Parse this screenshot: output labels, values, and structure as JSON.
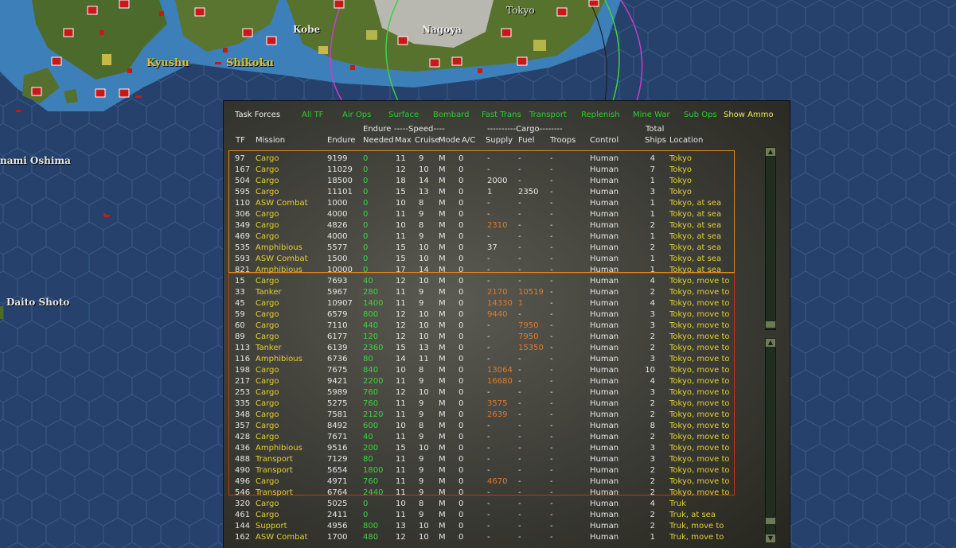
{
  "map": {
    "labels": [
      "Kobe",
      "Nagoya",
      "Tokyo",
      "Kyushu",
      "Shikoku",
      "nami Oshima",
      "Daito Shoto"
    ]
  },
  "tabs": [
    "Task Forces",
    "All TF",
    "Air Ops",
    "Surface",
    "Bombard",
    "Fast Trans",
    "Transport",
    "Replenish",
    "Mine War",
    "Sub Ops",
    "Show Ammo"
  ],
  "headers": {
    "endure_top": "Endure",
    "speed_top": "-----Speed----",
    "cargo_top": "----------Cargo--------",
    "total_top": "Total",
    "tf": "TF",
    "mission": "Mission",
    "endure": "Endure",
    "needed": "Needed",
    "max": "Max",
    "cruise": "Cruise",
    "mode": "Mode",
    "ac": "A/C",
    "supply": "Supply",
    "fuel": "Fuel",
    "troops": "Troops",
    "control": "Control",
    "ships": "Ships",
    "location": "Location"
  },
  "colors": {
    "yellow": "#e3cf2e",
    "green": "#3fd23f",
    "orange": "#e07a2a",
    "white": "#e6e6e6",
    "group_tokyo_border": "#d98a1a",
    "group_moveto_border": "#c8321e"
  },
  "rows": [
    {
      "tf": "97",
      "mission": "Cargo",
      "endure": "9199",
      "needed": "0",
      "max": "11",
      "cruise": "9",
      "mode": "M",
      "ac": "0",
      "supply": "-",
      "fuel": "-",
      "troops": "-",
      "control": "Human",
      "ships": "4",
      "location": "Tokyo"
    },
    {
      "tf": "167",
      "mission": "Cargo",
      "endure": "11029",
      "needed": "0",
      "max": "12",
      "cruise": "10",
      "mode": "M",
      "ac": "0",
      "supply": "-",
      "fuel": "-",
      "troops": "-",
      "control": "Human",
      "ships": "7",
      "location": "Tokyo"
    },
    {
      "tf": "504",
      "mission": "Cargo",
      "endure": "18500",
      "needed": "0",
      "max": "18",
      "cruise": "14",
      "mode": "M",
      "ac": "0",
      "supply": "2000",
      "fuel": "-",
      "troops": "-",
      "control": "Human",
      "ships": "1",
      "location": "Tokyo"
    },
    {
      "tf": "595",
      "mission": "Cargo",
      "endure": "11101",
      "needed": "0",
      "max": "15",
      "cruise": "13",
      "mode": "M",
      "ac": "0",
      "supply": "1",
      "fuel": "2350",
      "troops": "-",
      "control": "Human",
      "ships": "3",
      "location": "Tokyo"
    },
    {
      "tf": "110",
      "mission": "ASW Combat",
      "endure": "1000",
      "needed": "0",
      "max": "10",
      "cruise": "8",
      "mode": "M",
      "ac": "0",
      "supply": "-",
      "fuel": "-",
      "troops": "-",
      "control": "Human",
      "ships": "1",
      "location": "Tokyo, at sea"
    },
    {
      "tf": "306",
      "mission": "Cargo",
      "endure": "4000",
      "needed": "0",
      "max": "11",
      "cruise": "9",
      "mode": "M",
      "ac": "0",
      "supply": "-",
      "fuel": "-",
      "troops": "-",
      "control": "Human",
      "ships": "1",
      "location": "Tokyo, at sea"
    },
    {
      "tf": "349",
      "mission": "Cargo",
      "endure": "4826",
      "needed": "0",
      "max": "10",
      "cruise": "8",
      "mode": "M",
      "ac": "0",
      "supply": "2310",
      "fuel": "-",
      "troops": "-",
      "control": "Human",
      "ships": "2",
      "location": "Tokyo, at sea"
    },
    {
      "tf": "469",
      "mission": "Cargo",
      "endure": "4000",
      "needed": "0",
      "max": "11",
      "cruise": "9",
      "mode": "M",
      "ac": "0",
      "supply": "-",
      "fuel": "-",
      "troops": "-",
      "control": "Human",
      "ships": "1",
      "location": "Tokyo, at sea"
    },
    {
      "tf": "535",
      "mission": "Amphibious",
      "endure": "5577",
      "needed": "0",
      "max": "15",
      "cruise": "10",
      "mode": "M",
      "ac": "0",
      "supply": "37",
      "fuel": "-",
      "troops": "-",
      "control": "Human",
      "ships": "2",
      "location": "Tokyo, at sea"
    },
    {
      "tf": "593",
      "mission": "ASW Combat",
      "endure": "1500",
      "needed": "0",
      "max": "15",
      "cruise": "10",
      "mode": "M",
      "ac": "0",
      "supply": "-",
      "fuel": "-",
      "troops": "-",
      "control": "Human",
      "ships": "1",
      "location": "Tokyo, at sea"
    },
    {
      "tf": "821",
      "mission": "Amphibious",
      "endure": "10000",
      "needed": "0",
      "max": "17",
      "cruise": "14",
      "mode": "M",
      "ac": "0",
      "supply": "-",
      "fuel": "-",
      "troops": "-",
      "control": "Human",
      "ships": "1",
      "location": "Tokyo, at sea"
    },
    {
      "tf": "15",
      "mission": "Cargo",
      "endure": "7693",
      "needed": "40",
      "max": "12",
      "cruise": "10",
      "mode": "M",
      "ac": "0",
      "supply": "-",
      "fuel": "-",
      "troops": "-",
      "control": "Human",
      "ships": "4",
      "location": "Tokyo, move to"
    },
    {
      "tf": "33",
      "mission": "Tanker",
      "endure": "5967",
      "needed": "280",
      "max": "11",
      "cruise": "9",
      "mode": "M",
      "ac": "0",
      "supply": "2170",
      "fuel": "10519",
      "troops": "-",
      "control": "Human",
      "ships": "2",
      "location": "Tokyo, move to"
    },
    {
      "tf": "45",
      "mission": "Cargo",
      "endure": "10907",
      "needed": "1400",
      "max": "11",
      "cruise": "9",
      "mode": "M",
      "ac": "0",
      "supply": "14330",
      "fuel": "1",
      "troops": "-",
      "control": "Human",
      "ships": "4",
      "location": "Tokyo, move to"
    },
    {
      "tf": "59",
      "mission": "Cargo",
      "endure": "6579",
      "needed": "800",
      "max": "12",
      "cruise": "10",
      "mode": "M",
      "ac": "0",
      "supply": "9440",
      "fuel": "-",
      "troops": "-",
      "control": "Human",
      "ships": "3",
      "location": "Tokyo, move to"
    },
    {
      "tf": "60",
      "mission": "Cargo",
      "endure": "7110",
      "needed": "440",
      "max": "12",
      "cruise": "10",
      "mode": "M",
      "ac": "0",
      "supply": "-",
      "fuel": "7950",
      "troops": "-",
      "control": "Human",
      "ships": "3",
      "location": "Tokyo, move to"
    },
    {
      "tf": "89",
      "mission": "Cargo",
      "endure": "6177",
      "needed": "120",
      "max": "12",
      "cruise": "10",
      "mode": "M",
      "ac": "0",
      "supply": "-",
      "fuel": "7950",
      "troops": "-",
      "control": "Human",
      "ships": "2",
      "location": "Tokyo, move to"
    },
    {
      "tf": "113",
      "mission": "Tanker",
      "endure": "6139",
      "needed": "2360",
      "max": "15",
      "cruise": "13",
      "mode": "M",
      "ac": "0",
      "supply": "-",
      "fuel": "15350",
      "troops": "-",
      "control": "Human",
      "ships": "2",
      "location": "Tokyo, move to"
    },
    {
      "tf": "116",
      "mission": "Amphibious",
      "endure": "6736",
      "needed": "80",
      "max": "14",
      "cruise": "11",
      "mode": "M",
      "ac": "0",
      "supply": "-",
      "fuel": "-",
      "troops": "-",
      "control": "Human",
      "ships": "3",
      "location": "Tokyo, move to"
    },
    {
      "tf": "198",
      "mission": "Cargo",
      "endure": "7675",
      "needed": "840",
      "max": "10",
      "cruise": "8",
      "mode": "M",
      "ac": "0",
      "supply": "13064",
      "fuel": "-",
      "troops": "-",
      "control": "Human",
      "ships": "10",
      "location": "Tokyo, move to"
    },
    {
      "tf": "217",
      "mission": "Cargo",
      "endure": "9421",
      "needed": "2200",
      "max": "11",
      "cruise": "9",
      "mode": "M",
      "ac": "0",
      "supply": "16680",
      "fuel": "-",
      "troops": "-",
      "control": "Human",
      "ships": "4",
      "location": "Tokyo, move to"
    },
    {
      "tf": "253",
      "mission": "Cargo",
      "endure": "5989",
      "needed": "760",
      "max": "12",
      "cruise": "10",
      "mode": "M",
      "ac": "0",
      "supply": "-",
      "fuel": "-",
      "troops": "-",
      "control": "Human",
      "ships": "3",
      "location": "Tokyo, move to"
    },
    {
      "tf": "335",
      "mission": "Cargo",
      "endure": "5275",
      "needed": "760",
      "max": "11",
      "cruise": "9",
      "mode": "M",
      "ac": "0",
      "supply": "3575",
      "fuel": "-",
      "troops": "-",
      "control": "Human",
      "ships": "2",
      "location": "Tokyo, move to"
    },
    {
      "tf": "348",
      "mission": "Cargo",
      "endure": "7581",
      "needed": "2120",
      "max": "11",
      "cruise": "9",
      "mode": "M",
      "ac": "0",
      "supply": "2639",
      "fuel": "-",
      "troops": "-",
      "control": "Human",
      "ships": "2",
      "location": "Tokyo, move to"
    },
    {
      "tf": "357",
      "mission": "Cargo",
      "endure": "8492",
      "needed": "600",
      "max": "10",
      "cruise": "8",
      "mode": "M",
      "ac": "0",
      "supply": "-",
      "fuel": "-",
      "troops": "-",
      "control": "Human",
      "ships": "8",
      "location": "Tokyo, move to"
    },
    {
      "tf": "428",
      "mission": "Cargo",
      "endure": "7671",
      "needed": "40",
      "max": "11",
      "cruise": "9",
      "mode": "M",
      "ac": "0",
      "supply": "-",
      "fuel": "-",
      "troops": "-",
      "control": "Human",
      "ships": "2",
      "location": "Tokyo, move to"
    },
    {
      "tf": "436",
      "mission": "Amphibious",
      "endure": "9516",
      "needed": "200",
      "max": "15",
      "cruise": "10",
      "mode": "M",
      "ac": "0",
      "supply": "-",
      "fuel": "-",
      "troops": "-",
      "control": "Human",
      "ships": "3",
      "location": "Tokyo, move to"
    },
    {
      "tf": "488",
      "mission": "Transport",
      "endure": "7129",
      "needed": "80",
      "max": "11",
      "cruise": "9",
      "mode": "M",
      "ac": "0",
      "supply": "-",
      "fuel": "-",
      "troops": "-",
      "control": "Human",
      "ships": "3",
      "location": "Tokyo, move to"
    },
    {
      "tf": "490",
      "mission": "Transport",
      "endure": "5654",
      "needed": "1800",
      "max": "11",
      "cruise": "9",
      "mode": "M",
      "ac": "0",
      "supply": "-",
      "fuel": "-",
      "troops": "-",
      "control": "Human",
      "ships": "2",
      "location": "Tokyo, move to"
    },
    {
      "tf": "496",
      "mission": "Cargo",
      "endure": "4971",
      "needed": "760",
      "max": "11",
      "cruise": "9",
      "mode": "M",
      "ac": "0",
      "supply": "4670",
      "fuel": "-",
      "troops": "-",
      "control": "Human",
      "ships": "2",
      "location": "Tokyo, move to"
    },
    {
      "tf": "546",
      "mission": "Transport",
      "endure": "6764",
      "needed": "2440",
      "max": "11",
      "cruise": "9",
      "mode": "M",
      "ac": "0",
      "supply": "-",
      "fuel": "-",
      "troops": "-",
      "control": "Human",
      "ships": "2",
      "location": "Tokyo, move to"
    },
    {
      "tf": "320",
      "mission": "Cargo",
      "endure": "5025",
      "needed": "0",
      "max": "10",
      "cruise": "8",
      "mode": "M",
      "ac": "0",
      "supply": "-",
      "fuel": "-",
      "troops": "-",
      "control": "Human",
      "ships": "4",
      "location": "Truk"
    },
    {
      "tf": "461",
      "mission": "Cargo",
      "endure": "2411",
      "needed": "0",
      "max": "11",
      "cruise": "9",
      "mode": "M",
      "ac": "0",
      "supply": "-",
      "fuel": "-",
      "troops": "-",
      "control": "Human",
      "ships": "2",
      "location": "Truk, at sea"
    },
    {
      "tf": "144",
      "mission": "Support",
      "endure": "4956",
      "needed": "800",
      "max": "13",
      "cruise": "10",
      "mode": "M",
      "ac": "0",
      "supply": "-",
      "fuel": "-",
      "troops": "-",
      "control": "Human",
      "ships": "2",
      "location": "Truk, move to"
    },
    {
      "tf": "162",
      "mission": "ASW Combat",
      "endure": "1700",
      "needed": "480",
      "max": "12",
      "cruise": "10",
      "mode": "M",
      "ac": "0",
      "supply": "-",
      "fuel": "-",
      "troops": "-",
      "control": "Human",
      "ships": "1",
      "location": "Truk, move to"
    }
  ]
}
